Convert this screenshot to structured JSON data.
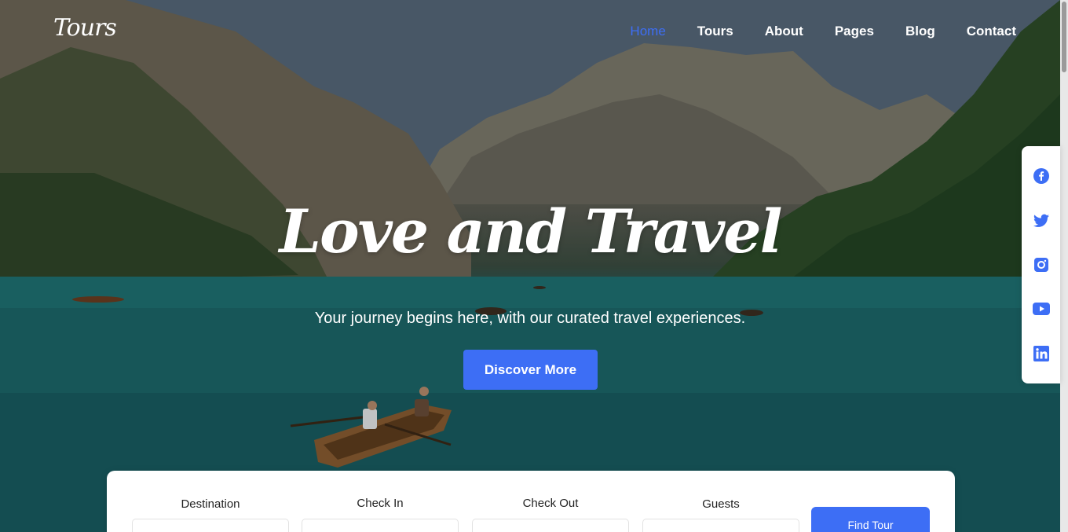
{
  "brand": {
    "logo_text": "Tours"
  },
  "nav": {
    "items": [
      {
        "label": "Home",
        "active": true
      },
      {
        "label": "Tours",
        "active": false
      },
      {
        "label": "About",
        "active": false
      },
      {
        "label": "Pages",
        "active": false
      },
      {
        "label": "Blog",
        "active": false
      },
      {
        "label": "Contact",
        "active": false
      }
    ]
  },
  "hero": {
    "title": "Love and Travel",
    "subtitle": "Your journey begins here, with our curated travel experiences.",
    "cta_label": "Discover More"
  },
  "social": {
    "icons": [
      "facebook-icon",
      "twitter-icon",
      "instagram-icon",
      "youtube-icon",
      "linkedin-icon"
    ]
  },
  "search": {
    "fields": [
      {
        "label": "Destination",
        "placeholder": ""
      },
      {
        "label": "Check In",
        "placeholder": ""
      },
      {
        "label": "Check Out",
        "placeholder": ""
      },
      {
        "label": "Guests",
        "placeholder": ""
      }
    ],
    "button_label": "Find Tour"
  },
  "colors": {
    "accent": "#3d6ef5",
    "white": "#ffffff"
  }
}
